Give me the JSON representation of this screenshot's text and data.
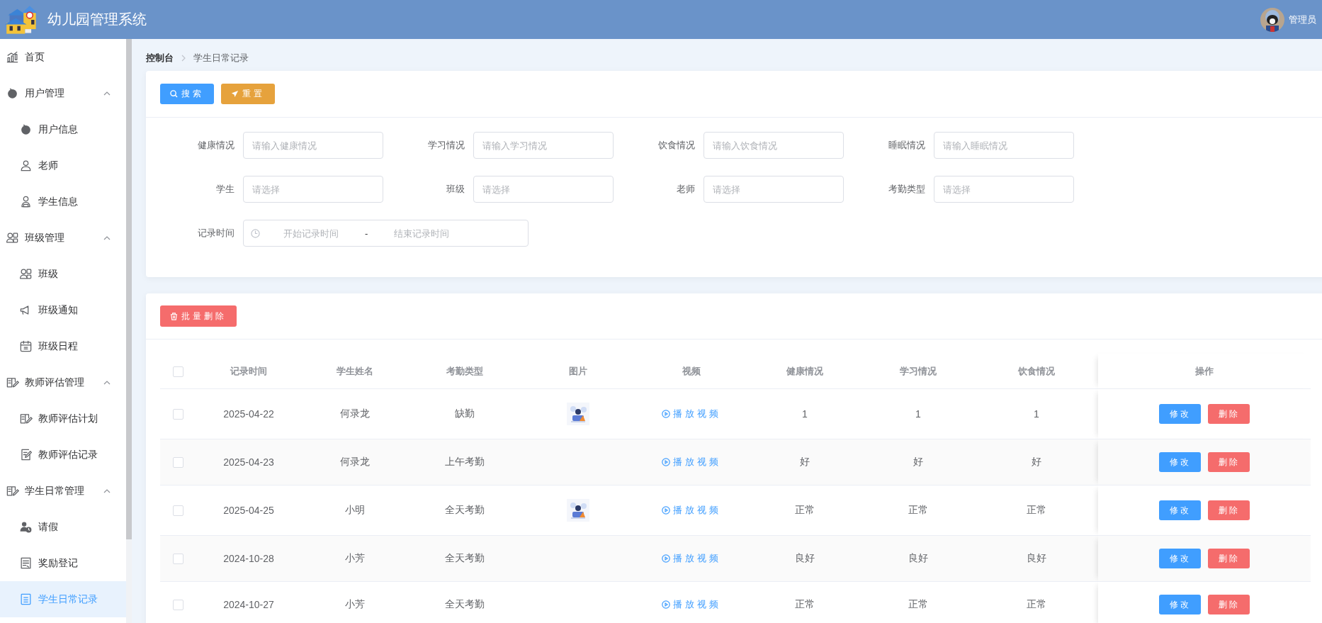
{
  "header": {
    "title": "幼儿园管理系统",
    "user": "管理员"
  },
  "sidebar": {
    "items": [
      {
        "label": "首页",
        "selected": false
      },
      {
        "label": "用户管理",
        "selected": false,
        "expanded": true,
        "children": [
          {
            "label": "用户信息",
            "selected": false
          },
          {
            "label": "老师",
            "selected": false
          },
          {
            "label": "学生信息",
            "selected": false
          }
        ]
      },
      {
        "label": "班级管理",
        "selected": false,
        "expanded": true,
        "children": [
          {
            "label": "班级",
            "selected": false
          },
          {
            "label": "班级通知",
            "selected": false
          },
          {
            "label": "班级日程",
            "selected": false
          }
        ]
      },
      {
        "label": "教师评估管理",
        "selected": false,
        "expanded": true,
        "children": [
          {
            "label": "教师评估计划",
            "selected": false
          },
          {
            "label": "教师评估记录",
            "selected": false
          }
        ]
      },
      {
        "label": "学生日常管理",
        "selected": false,
        "expanded": true,
        "children": [
          {
            "label": "请假",
            "selected": false
          },
          {
            "label": "奖励登记",
            "selected": false
          },
          {
            "label": "学生日常记录",
            "selected": true
          }
        ]
      }
    ]
  },
  "breadcrumb": [
    "控制台",
    "学生日常记录"
  ],
  "search_panel": {
    "buttons": [
      {
        "label": "搜索",
        "kind": "search"
      },
      {
        "label": "重置",
        "kind": "reset"
      }
    ],
    "fields": [
      {
        "label": "健康情况",
        "placeholder": "请输入健康情况"
      },
      {
        "label": "学习情况",
        "placeholder": "请输入学习情况"
      },
      {
        "label": "饮食情况",
        "placeholder": "请输入饮食情况"
      },
      {
        "label": "睡眠情况",
        "placeholder": "请输入睡眠情况"
      },
      {
        "label": "学生",
        "placeholder": "请选择"
      },
      {
        "label": "班级",
        "placeholder": "请选择"
      },
      {
        "label": "老师",
        "placeholder": "请选择"
      },
      {
        "label": "考勤类型",
        "placeholder": "请选择"
      }
    ],
    "date_range": {
      "label": "记录时间",
      "start_placeholder": "开始记录时间",
      "separator": "-",
      "end_placeholder": "结束记录时间"
    }
  },
  "table": {
    "batch_delete": "批量删除",
    "header_checked": false,
    "columns": [
      "记录时间",
      "学生姓名",
      "考勤类型",
      "图片",
      "视频",
      "健康情况",
      "学习情况",
      "饮食情况",
      "操作"
    ],
    "rows": [
      {
        "checked": false,
        "date": "2025-04-22",
        "student": "何录龙",
        "attendance": "缺勤",
        "image": {
          "kind": "picture"
        },
        "video": "播放视频",
        "health": "1",
        "study": "1",
        "diet": "1",
        "actions": [
          "修改",
          "删除"
        ]
      },
      {
        "checked": false,
        "date": "2025-04-23",
        "student": "何录龙",
        "attendance": "上午考勤",
        "video": "播放视频",
        "health": "好",
        "study": "好",
        "diet": "好",
        "actions": [
          "修改",
          "删除"
        ]
      },
      {
        "checked": false,
        "date": "2025-04-25",
        "student": "小明",
        "attendance": "全天考勤",
        "image": {
          "kind": "picture"
        },
        "video": "播放视频",
        "health": "正常",
        "study": "正常",
        "diet": "正常",
        "actions": [
          "修改",
          "删除"
        ]
      },
      {
        "checked": false,
        "date": "2024-10-28",
        "student": "小芳",
        "attendance": "全天考勤",
        "video": "播放视频",
        "health": "良好",
        "study": "良好",
        "diet": "良好",
        "actions": [
          "修改",
          "删除"
        ]
      },
      {
        "checked": false,
        "date": "2024-10-27",
        "student": "小芳",
        "attendance": "全天考勤",
        "video": "播放视频",
        "health": "正常",
        "study": "正常",
        "diet": "正常",
        "actions": [
          "修改",
          "删除"
        ]
      }
    ]
  }
}
